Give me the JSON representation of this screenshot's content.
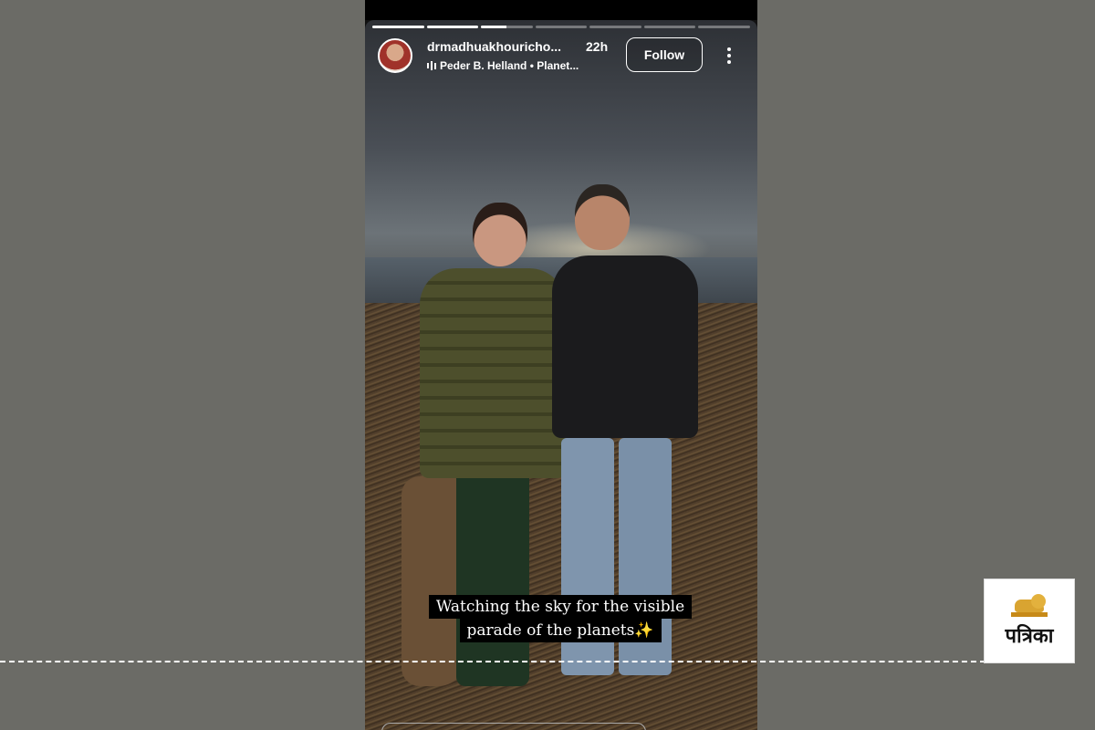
{
  "story": {
    "progress": {
      "segments": 7,
      "current_index": 2,
      "current_fraction": 0.5
    },
    "header": {
      "username": "drmadhuakhouricho...",
      "time_ago": "22h",
      "music": "Peder B. Helland • Planet...",
      "follow_label": "Follow"
    },
    "caption": {
      "line1": "Watching the sky for the visible",
      "line2": "parade of the planets✨"
    }
  },
  "watermark": {
    "logo_text": "पत्रिका",
    "colors": {
      "lion": "#d9a431",
      "background": "#ffffff"
    }
  },
  "icons": [
    "music-bars-icon",
    "more-options-icon",
    "lion-emblem-icon"
  ],
  "colors": {
    "page_background": "#6b6b66",
    "story_background": "#111111"
  }
}
